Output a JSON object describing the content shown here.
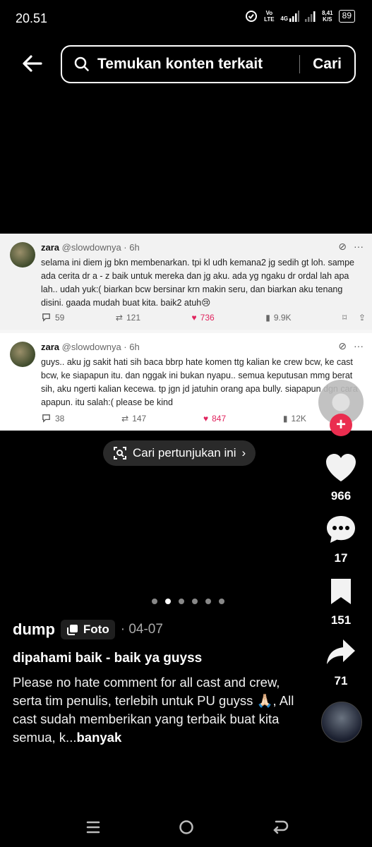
{
  "status": {
    "time": "20.51",
    "volte": "Vo LTE",
    "network": "4G",
    "speed": "8,41",
    "speed_unit": "K/S",
    "battery": "89"
  },
  "search": {
    "placeholder": "Temukan konten terkait",
    "button": "Cari"
  },
  "tweets": [
    {
      "name": "zara",
      "handle": "@slowdownya · 6h",
      "text": "selama ini diem jg bkn membenarkan. tpi kl udh kemana2 jg sedih gt loh. sampe ada cerita dr a - z baik untuk mereka dan jg aku. ada yg ngaku dr ordal lah apa lah.. udah yuk:( biarkan bcw bersinar krn makin seru, dan biarkan aku tenang disini. gaada mudah buat kita. baik2 atuh😢",
      "replies": "59",
      "retweets": "121",
      "likes": "736",
      "views": "9.9K"
    },
    {
      "name": "zara",
      "handle": "@slowdownya · 6h",
      "text": "guys.. aku jg sakit hati sih baca bbrp hate komen ttg kalian ke crew bcw, ke cast bcw, ke siapapun itu. dan nggak ini bukan nyapu.. semua keputusan mmg berat sih, aku ngerti kalian kecewa. tp jgn jd jatuhin orang apa bully. siapapun dgn cara apapun. itu salah:( please be kind",
      "replies": "38",
      "retweets": "147",
      "likes": "847",
      "views": "12K"
    }
  ],
  "cari_pill": "Cari pertunjukan ini",
  "rail": {
    "likes": "966",
    "comments": "17",
    "saves": "151",
    "shares": "71"
  },
  "caption": {
    "author": "dump",
    "badge": "Foto",
    "date": "· 04-07",
    "title": "dipahami baik - baik ya guyss",
    "description": "Please no hate comment for all cast and crew, serta tim penulis, terlebih untuk PU guyss 🙏🏻, All cast sudah memberikan yang terbaik buat kita semua, k...",
    "more": "banyak"
  },
  "carousel": {
    "total": 6,
    "active": 2
  },
  "colors": {
    "accent": "#ea2d4f",
    "like_pink": "#e0245e"
  }
}
